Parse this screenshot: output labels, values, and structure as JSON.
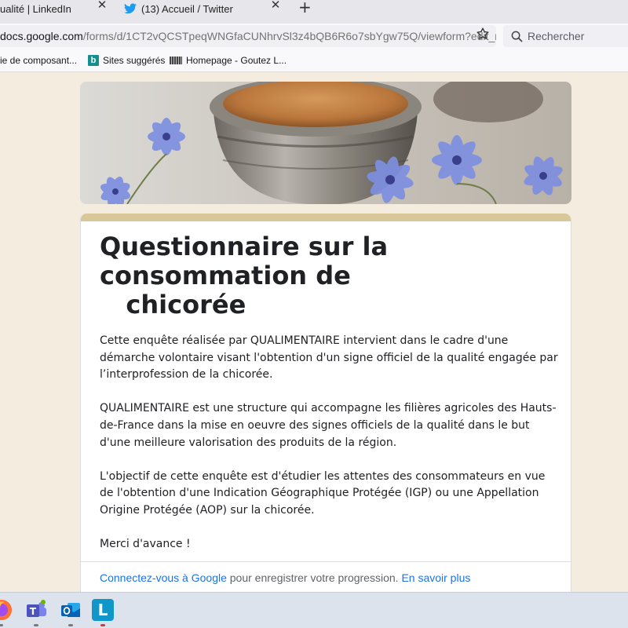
{
  "browser": {
    "tabs": [
      {
        "label": "ualité | LinkedIn"
      },
      {
        "label": "(13) Accueil / Twitter"
      }
    ],
    "url_host": "docs.google.com",
    "url_path": "/forms/d/1CT2vQCSTpeqWNGfaCUNhrvSl3z4bQB6R6o7sbYgw75Q/viewform?edit_re",
    "search_placeholder": "Rechercher",
    "bookmarks": [
      {
        "label": "ie de composant..."
      },
      {
        "label": "Sites suggérés"
      },
      {
        "label": "Homepage - Goutez L..."
      }
    ],
    "bing_letter": "b"
  },
  "form": {
    "title": "Questionnaire sur la consommation de\n   chicorée",
    "paragraphs": [
      "Cette enquête réalisée par QUALIMENTAIRE  intervient dans le cadre d'une démarche volontaire visant l'obtention d'un signe officiel de la qualité engagée par l’interprofession de la chicorée.",
      "QUALIMENTAIRE est une structure qui accompagne les filières agricoles des Hauts-de-France dans la mise en oeuvre des signes officiels de la qualité dans le but d'une meilleure valorisation des produits de la région.",
      "L'objectif de cette enquête est d'étudier les attentes des consommateurs en vue de l'obtention d'une Indication Géographique Protégée (IGP) ou une Appellation Origine Protégée (AOP) sur la chicorée.",
      "Merci d'avance !"
    ],
    "signin_link": "Connectez-vous à Google",
    "signin_text": " pour enregistrer votre progression. ",
    "learn_more": "En savoir plus"
  },
  "taskbar": {
    "lucid_letter": "L"
  },
  "colors": {
    "page_bg": "#f3ecdf",
    "accent": "#d9c79a",
    "link": "#1a73e8"
  }
}
